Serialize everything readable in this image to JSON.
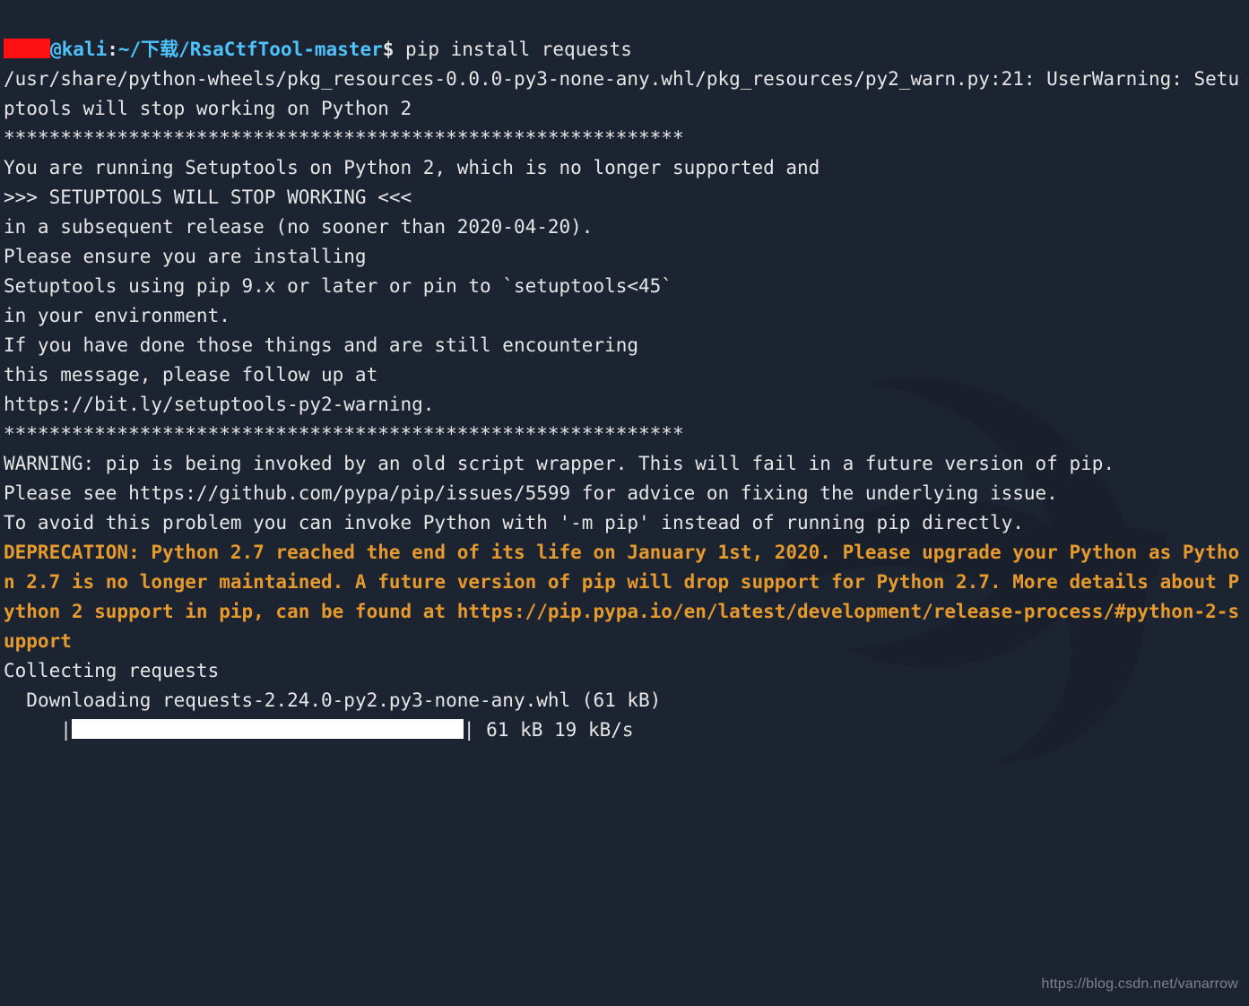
{
  "prompt": {
    "host": "@kali",
    "sep": ":",
    "path": "~/下载/RsaCtfTool-master",
    "dollar": "$",
    "command": " pip install requests"
  },
  "out": {
    "l1": "/usr/share/python-wheels/pkg_resources-0.0.0-py3-none-any.whl/pkg_resources/py2_warn.py:21: UserWarning: Setuptools will stop working on Python 2",
    "l2": "************************************************************",
    "l3": "You are running Setuptools on Python 2, which is no longer supported and",
    "l4": ">>> SETUPTOOLS WILL STOP WORKING <<<",
    "l5": "in a subsequent release (no sooner than 2020-04-20).",
    "l6": "Please ensure you are installing",
    "l7": "Setuptools using pip 9.x or later or pin to `setuptools<45`",
    "l8": "in your environment.",
    "l9": "If you have done those things and are still encountering",
    "l10": "this message, please follow up at",
    "l11": "https://bit.ly/setuptools-py2-warning.",
    "l12": "************************************************************",
    "l13": "WARNING: pip is being invoked by an old script wrapper. This will fail in a future version of pip.",
    "l14": "Please see https://github.com/pypa/pip/issues/5599 for advice on fixing the underlying issue.",
    "l15": "To avoid this problem you can invoke Python with '-m pip' instead of running pip directly.",
    "deprecation": "DEPRECATION: Python 2.7 reached the end of its life on January 1st, 2020. Please upgrade your Python as Python 2.7 is no longer maintained. A future version of pip will drop support for Python 2.7. More details about Python 2 support in pip, can be found at https://pip.pypa.io/en/latest/development/release-process/#python-2-support",
    "collecting": "Collecting requests",
    "downloading": "  Downloading requests-2.24.0-py2.py3-none-any.whl (61 kB)",
    "progress_prefix": "     |",
    "progress_suffix": "| 61 kB 19 kB/s"
  },
  "watermark": "https://blog.csdn.net/vanarrow"
}
